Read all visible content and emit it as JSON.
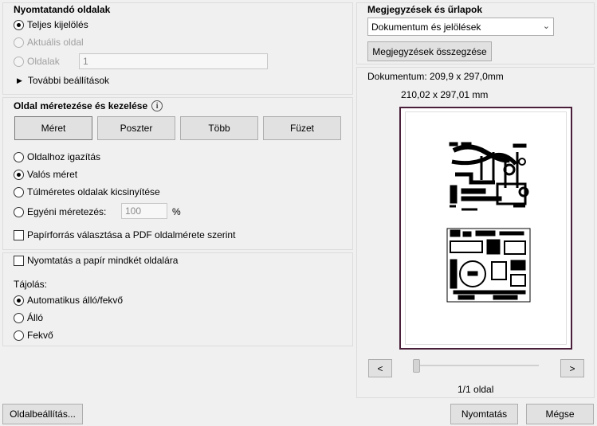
{
  "pages": {
    "title": "Nyomtatandó oldalak",
    "all": "Teljes kijelölés",
    "current": "Aktuális oldal",
    "pages_label": "Oldalak",
    "pages_value": "1",
    "more": "További beállítások"
  },
  "sizing": {
    "title": "Oldal méretezése és kezelése",
    "tabs": [
      "Méret",
      "Poszter",
      "Több",
      "Füzet"
    ],
    "fit": "Oldalhoz igazítás",
    "actual": "Valós méret",
    "shrink": "Túlméretes oldalak kicsinyítése",
    "custom": "Egyéni méretezés:",
    "custom_value": "100",
    "percent": "%",
    "paper_source": "Papírforrás választása a PDF oldalmérete szerint"
  },
  "duplex": {
    "label": "Nyomtatás a papír mindkét oldalára"
  },
  "orientation": {
    "title": "Tájolás:",
    "auto": "Automatikus álló/fekvő",
    "portrait": "Álló",
    "landscape": "Fekvő"
  },
  "comments": {
    "title": "Megjegyzések és űrlapok",
    "selected": "Dokumentum és jelölések",
    "summary_button": "Megjegyzések összegzése"
  },
  "preview": {
    "doc_size": "Dokumentum: 209,9 x 297,0mm",
    "page_size": "210,02 x 297,01 mm",
    "page_counter": "1/1 oldal",
    "prev": "<",
    "next": ">"
  },
  "footer": {
    "page_setup": "Oldalbeállítás...",
    "print": "Nyomtatás",
    "cancel": "Mégse"
  }
}
